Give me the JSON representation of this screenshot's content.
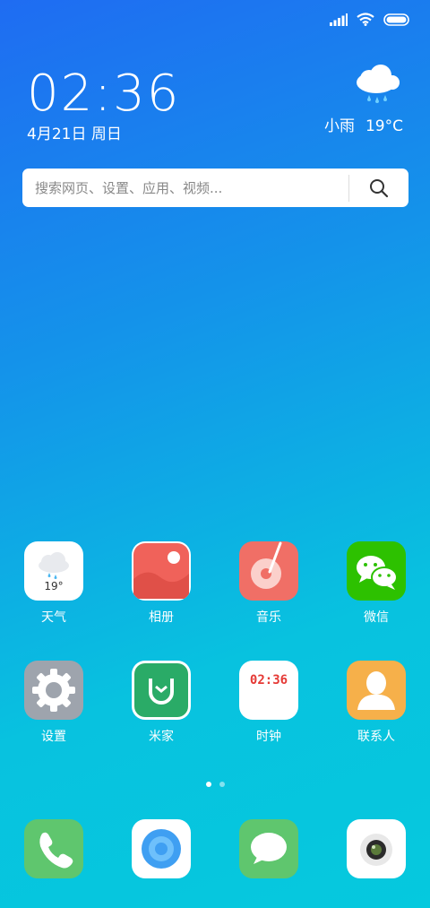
{
  "status_bar": {
    "signal_icon": "signal-icon",
    "wifi_icon": "wifi-icon",
    "battery_icon": "battery-icon"
  },
  "clock": {
    "time": "02:36",
    "date": "4月21日 周日"
  },
  "weather_widget": {
    "condition": "小雨",
    "temp": "19°C",
    "icon": "rain-cloud-icon"
  },
  "search": {
    "placeholder": "搜索网页、设置、应用、视频..."
  },
  "apps_row1": [
    {
      "label": "天气",
      "icon": "weather-app-icon",
      "icon_text": "19°"
    },
    {
      "label": "相册",
      "icon": "gallery-app-icon"
    },
    {
      "label": "音乐",
      "icon": "music-app-icon"
    },
    {
      "label": "微信",
      "icon": "wechat-app-icon"
    }
  ],
  "apps_row2": [
    {
      "label": "设置",
      "icon": "settings-app-icon"
    },
    {
      "label": "米家",
      "icon": "mijia-app-icon"
    },
    {
      "label": "时钟",
      "icon": "clock-app-icon",
      "icon_text": "02:36"
    },
    {
      "label": "联系人",
      "icon": "contacts-app-icon"
    }
  ],
  "page_indicator": {
    "pages": 2,
    "current": 1
  },
  "dock": [
    {
      "icon": "phone-app-icon"
    },
    {
      "icon": "browser-app-icon"
    },
    {
      "icon": "messages-app-icon"
    },
    {
      "icon": "camera-app-icon"
    }
  ]
}
